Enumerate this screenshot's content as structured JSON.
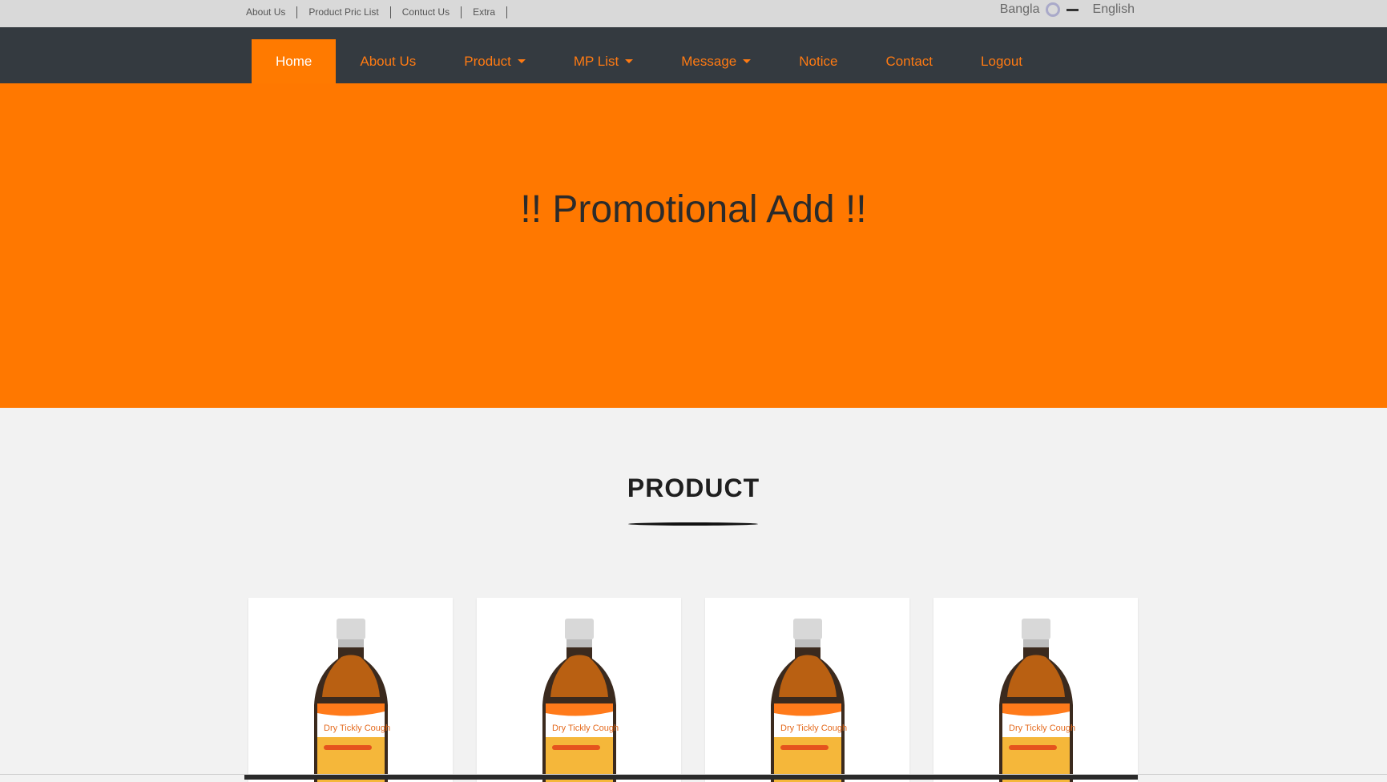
{
  "topbar": {
    "links": [
      "About Us",
      "Product Pric List",
      "Contuct Us",
      "Extra"
    ],
    "lang_bangla": "Bangla",
    "lang_english": "English"
  },
  "nav": {
    "items": [
      {
        "label": "Home",
        "active": true,
        "dropdown": false
      },
      {
        "label": "About Us",
        "dropdown": false
      },
      {
        "label": "Product",
        "dropdown": true
      },
      {
        "label": "MP List",
        "dropdown": true
      },
      {
        "label": "Message",
        "dropdown": true
      },
      {
        "label": "Notice",
        "dropdown": false
      },
      {
        "label": "Contact",
        "dropdown": false
      },
      {
        "label": "Logout",
        "dropdown": false
      }
    ]
  },
  "hero": {
    "title": "!! Promotional Add !!"
  },
  "products_section": {
    "title": "PRODUCT",
    "items": [
      {
        "label_line1": "Dry Tickly Cough"
      },
      {
        "label_line1": "Dry Tickly Cough"
      },
      {
        "label_line1": "Dry Tickly Cough"
      },
      {
        "label_line1": "Dry Tickly Cough"
      }
    ]
  },
  "colors": {
    "accent": "#ff7800",
    "navbar": "#343a40",
    "topbar": "#d9d9d9"
  }
}
